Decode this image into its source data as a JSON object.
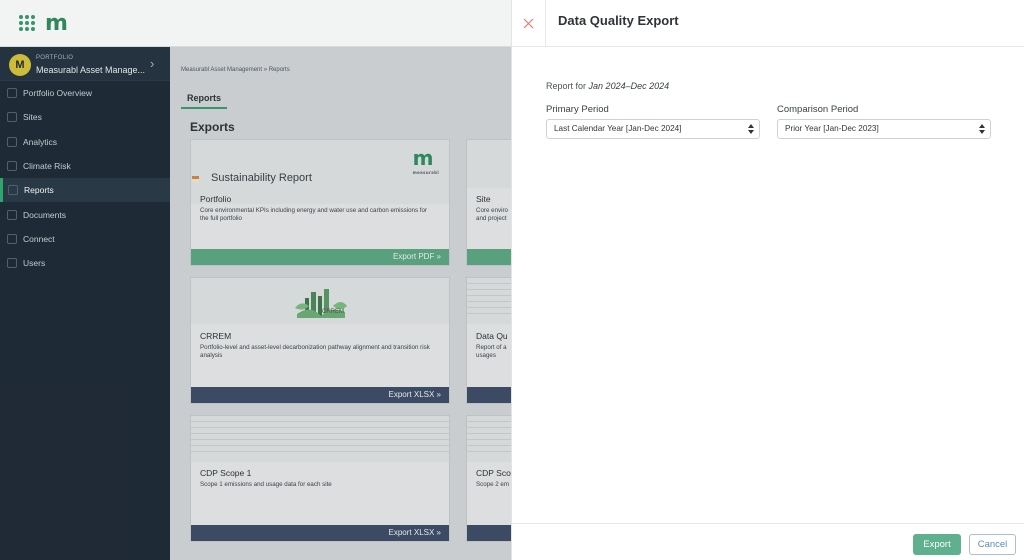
{
  "app": {
    "logo_text": "m",
    "brand_color": "#2f8e5f"
  },
  "sidebar": {
    "portfolio_kicker": "PORTFOLIO",
    "portfolio_name": "Measurabl Asset Manage...",
    "avatar_letter": "M",
    "items": [
      {
        "label": "Portfolio Overview",
        "icon": "overview-icon"
      },
      {
        "label": "Sites",
        "icon": "sites-icon"
      },
      {
        "label": "Analytics",
        "icon": "analytics-icon"
      },
      {
        "label": "Climate Risk",
        "icon": "climate-icon"
      },
      {
        "label": "Reports",
        "icon": "reports-icon"
      },
      {
        "label": "Documents",
        "icon": "documents-icon"
      },
      {
        "label": "Connect",
        "icon": "connect-icon"
      },
      {
        "label": "Users",
        "icon": "users-icon"
      }
    ]
  },
  "main": {
    "breadcrumb": "Measurabl Asset Management  »  Reports",
    "tab": "Reports",
    "section_title": "Exports",
    "cards": [
      {
        "thumb_title": "Sustainability Report",
        "title": "Portfolio",
        "desc": "Core environmental KPIs including energy and water use and carbon emissions for the full portfolio",
        "button": "Export PDF »",
        "logo_caption": "measurabl"
      },
      {
        "title": "Site",
        "desc": "Core enviro and project",
        "button": ""
      },
      {
        "thumb_title": "CRREM",
        "title": "CRREM",
        "desc": "Portfolio-level and asset-level decarbonization pathway alignment and transition risk analysis",
        "button": "Export XLSX »"
      },
      {
        "title": "Data Qu",
        "desc": "Report of a usages",
        "button": ""
      },
      {
        "title": "CDP Scope 1",
        "desc": "Scope 1 emissions and usage data for each site",
        "button": "Export XLSX »"
      },
      {
        "title": "CDP Scop",
        "desc": "Scope 2 em",
        "button": ""
      }
    ]
  },
  "modal": {
    "title": "Data Quality Export",
    "report_for_prefix": "Report for",
    "report_for_range": "Jan 2024–Dec 2024",
    "primary_label": "Primary Period",
    "primary_value": "Last Calendar Year [Jan-Dec 2024]",
    "comparison_label": "Comparison Period",
    "comparison_value": "Prior Year [Jan-Dec 2023]",
    "export_label": "Export",
    "cancel_label": "Cancel",
    "accent_color": "#5fb08e",
    "close_color": "#e07b74"
  }
}
